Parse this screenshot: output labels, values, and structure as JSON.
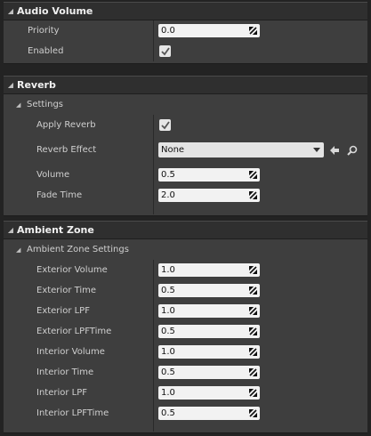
{
  "audio_volume": {
    "title": "Audio Volume",
    "priority_label": "Priority",
    "priority_value": "0.0",
    "enabled_label": "Enabled",
    "enabled_checked": true
  },
  "reverb": {
    "title": "Reverb",
    "settings_label": "Settings",
    "apply_reverb_label": "Apply Reverb",
    "apply_reverb_checked": true,
    "reverb_effect_label": "Reverb Effect",
    "reverb_effect_value": "None",
    "volume_label": "Volume",
    "volume_value": "0.5",
    "fade_time_label": "Fade Time",
    "fade_time_value": "2.0"
  },
  "ambient_zone": {
    "title": "Ambient Zone",
    "settings_label": "Ambient Zone Settings",
    "rows": [
      {
        "label": "Exterior Volume",
        "value": "1.0"
      },
      {
        "label": "Exterior Time",
        "value": "0.5"
      },
      {
        "label": "Exterior LPF",
        "value": "1.0"
      },
      {
        "label": "Exterior LPFTime",
        "value": "0.5"
      },
      {
        "label": "Interior Volume",
        "value": "1.0"
      },
      {
        "label": "Interior Time",
        "value": "0.5"
      },
      {
        "label": "Interior LPF",
        "value": "1.0"
      },
      {
        "label": "Interior LPFTime",
        "value": "0.5"
      }
    ]
  },
  "icons": {
    "collapse": "triangle-down-icon",
    "drag": "drag-handle-icon",
    "check": "checkmark-icon",
    "use_selected": "arrow-left-icon",
    "browse": "magnifier-icon"
  }
}
